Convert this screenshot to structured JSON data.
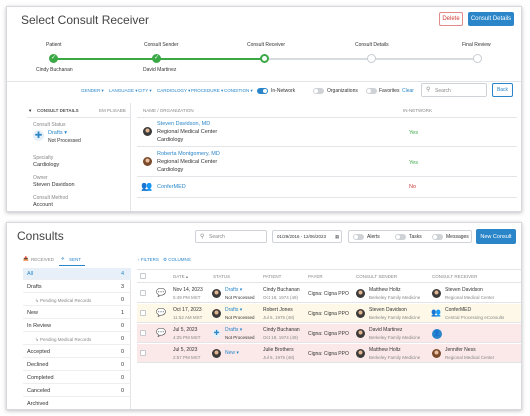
{
  "top": {
    "title": "Select Consult Receiver",
    "delete_label": "Delete",
    "consult_details_label": "Consult Details",
    "steps": [
      {
        "label": "Patient",
        "value": "Cindy Buchanan"
      },
      {
        "label": "Consult Sender",
        "value": "David Martinez"
      },
      {
        "label": "Consult Receiver",
        "value": ""
      },
      {
        "label": "Consult Details",
        "value": ""
      },
      {
        "label": "Final Review",
        "value": ""
      }
    ],
    "filters": [
      "GENDER ▾",
      "LANGUAGE ▾",
      "CITY ▾",
      "CARDIOLOGY ▾",
      "PROCEDURE ▾",
      "CONDITION ▾"
    ],
    "in_network_label": "In-Network",
    "organizations_label": "Organizations",
    "favorites_label": "Favorites",
    "clear_label": "Clear",
    "search_placeholder": "Search",
    "back_label": "Back",
    "sidebar": {
      "header": "CONSULT DETAILS",
      "ehr": "EM PLISABB",
      "status_label": "Consult Status",
      "status_value": "Drafts ▾",
      "status_sub": "Not Processed",
      "specialty_label": "Specialty",
      "specialty_value": "Cardiology",
      "owner_label": "Owner",
      "owner_value": "Steven Davidson",
      "method_label": "Consult Method",
      "method_value": "Account"
    },
    "table_headers": [
      "NAME / ORGANIZATION",
      "IN-NETWORK"
    ],
    "rows": [
      {
        "name": "Steven Davidson, MD",
        "org": "Regional Medical Center",
        "spec": "Cardiology",
        "net": "Yes"
      },
      {
        "name": "Roberta Montgomery, MD",
        "org": "Regional Medical Center",
        "spec": "Cardiology",
        "net": "Yes"
      },
      {
        "name": "ConferMED",
        "org": "",
        "spec": "",
        "net": "No"
      }
    ]
  },
  "bottom": {
    "title": "Consults",
    "search_placeholder": "Search",
    "date_range": "01/29/2016 - 12/06/2023",
    "toggles": [
      "Alerts",
      "Tasks",
      "Messages"
    ],
    "new_consult_label": "New Consult",
    "tabs": [
      "RECEIVED",
      "SENT"
    ],
    "filters_label": "FILTERS",
    "columns_label": "COLUMNS",
    "sidebar": [
      {
        "label": "All",
        "count": "4"
      },
      {
        "label": "Drafts",
        "count": "3"
      },
      {
        "label": "↳ Pending Medical Records",
        "count": "0"
      },
      {
        "label": "New",
        "count": "1"
      },
      {
        "label": "In Review",
        "count": "0"
      },
      {
        "label": "↳ Pending Medical Records",
        "count": "0"
      },
      {
        "label": "Accepted",
        "count": "0"
      },
      {
        "label": "Declined",
        "count": "0"
      },
      {
        "label": "Completed",
        "count": "0"
      },
      {
        "label": "Canceled",
        "count": "0"
      },
      {
        "label": "Archived",
        "count": ""
      }
    ],
    "headers": [
      "DATE ▴",
      "STATUS",
      "PATIENT",
      "PAYER",
      "CONSULT SENDER",
      "CONSULT RECEIVER"
    ],
    "rows": [
      {
        "date": "Nov 14, 2023",
        "time": "5:49 PM MST",
        "status": "Drafts ▾",
        "status_sub": "Not Processed",
        "patient": "Cindy Buchanan",
        "dob": "Oct 18, 1974 (49)",
        "payer": "Cigna: Cigna PPO",
        "sender": "Matthew Holtz",
        "sender_org": "Berkeley Family Medicine",
        "receiver": "Steven Davidson",
        "receiver_org": "Regional Medical Center",
        "bg": "#ffffff"
      },
      {
        "date": "Oct 17, 2023",
        "time": "11:52 AM MST",
        "status": "Drafts ▾",
        "status_sub": "Not Processed",
        "patient": "Robert Jones",
        "dob": "Jul 6, 1975 (48)",
        "payer": "Cigna: Cigna PPO",
        "sender": "Steven Davidson",
        "sender_org": "Berkeley Family Medicine",
        "receiver": "ConferMED",
        "receiver_org": "Central Processing eConsults",
        "bg": "#fdf8e8"
      },
      {
        "date": "Jul 5, 2023",
        "time": "4:25 PM MST",
        "status": "Drafts ▾",
        "status_sub": "Not Processed",
        "patient": "Cindy Buchanan",
        "dob": "Oct 18, 1974 (49)",
        "payer": "Cigna: Cigna PPO",
        "sender": "David Martinez",
        "sender_org": "Berkeley Family Medicine",
        "receiver": "",
        "receiver_org": "",
        "bg": "#fbe9e9"
      },
      {
        "date": "Jul 5, 2023",
        "time": "2:57 PM MST",
        "status": "New ▾",
        "status_sub": "",
        "patient": "Julie Brothers",
        "dob": "Jul 6, 1975 (48)",
        "payer": "Cigna: Cigna PPO",
        "sender": "Matthew Holtz",
        "sender_org": "Berkeley Family Medicine",
        "receiver": "Jennifer Ness",
        "receiver_org": "Regional Medical Center",
        "bg": "#fbe9e9"
      }
    ]
  }
}
